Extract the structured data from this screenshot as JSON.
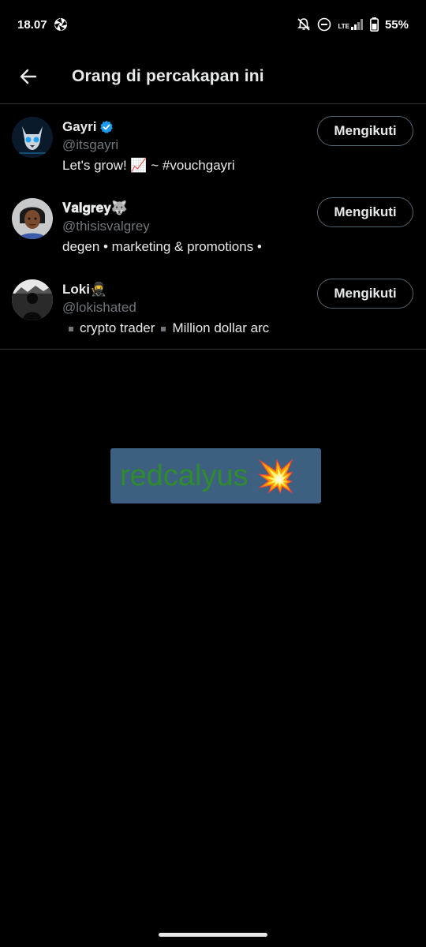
{
  "status": {
    "time": "18.07",
    "network": "LTE",
    "battery": "55%"
  },
  "header": {
    "title": "Orang di percakapan ini"
  },
  "users": [
    {
      "name": "Gayri",
      "verified": true,
      "handle": "@itsgayri",
      "bio": "Let's grow! 📈 ~ #vouchgayri",
      "button": "Mengikuti"
    },
    {
      "name": "𝐕𝐚𝐥𝐠𝐫𝐞𝐲🐺",
      "handle": "@thisisvalgrey",
      "bio": "degen • marketing & promotions •",
      "button": "Mengikuti"
    },
    {
      "name": "Loki🥷",
      "handle": "@lokishated",
      "bio_parts": [
        "crypto trader",
        "Million dollar arc"
      ],
      "button": "Mengikuti"
    }
  ],
  "watermark": {
    "text": "redcalyus",
    "emoji": "💥"
  },
  "colors": {
    "background": "#000000",
    "text": "#e7e9ea",
    "secondary": "#71767b",
    "verified": "#1d9bf0",
    "divider": "#2f3336",
    "watermark_bg": "#3d5f80",
    "watermark_text": "#2e8b2e"
  }
}
